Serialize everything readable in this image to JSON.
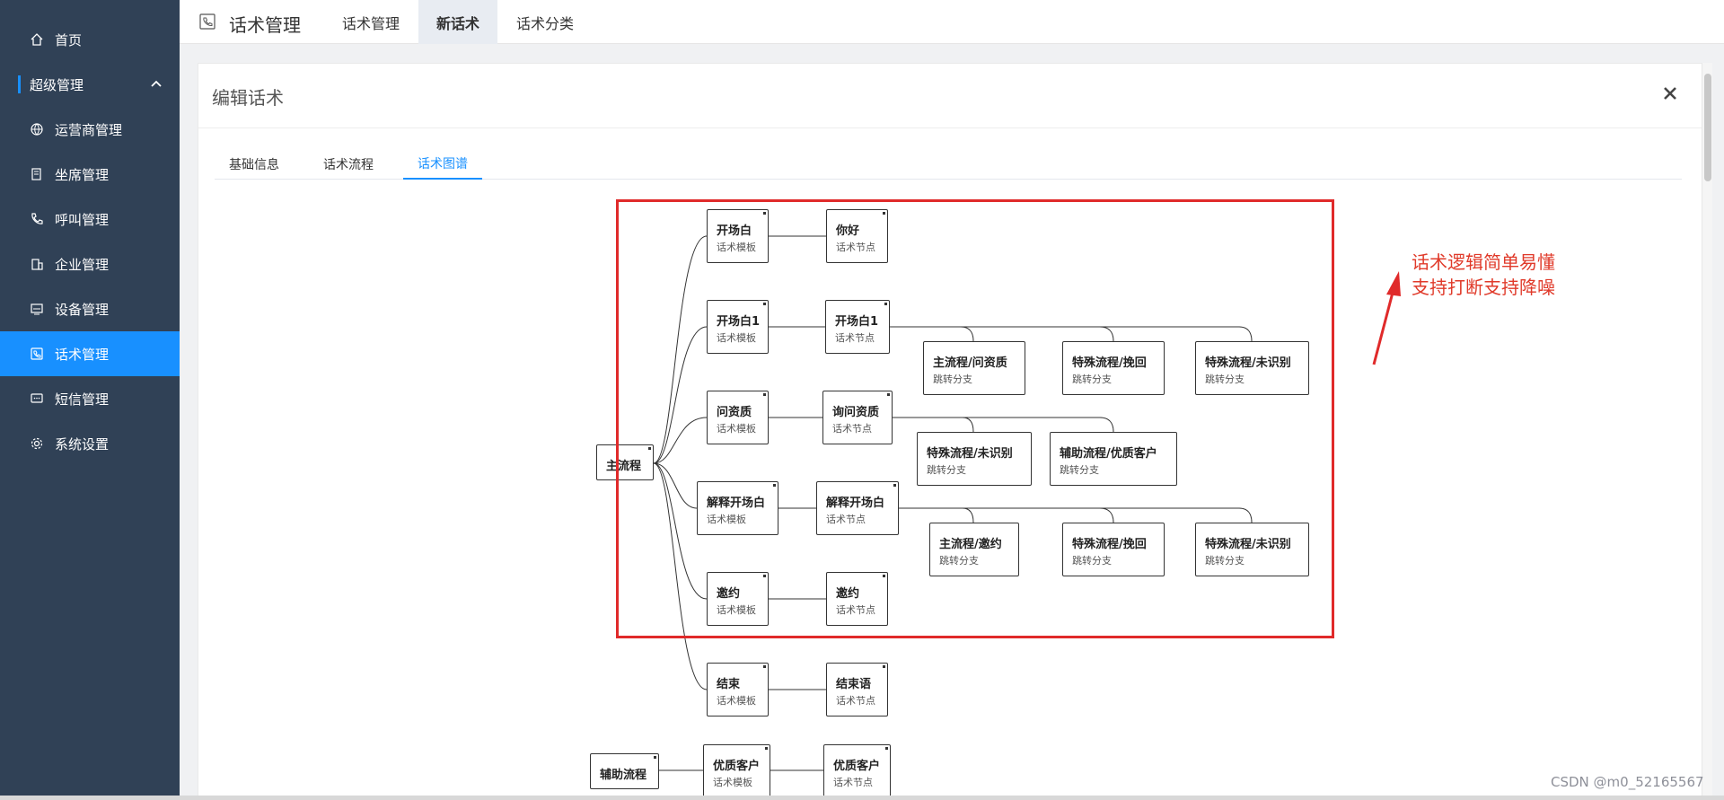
{
  "sidebar": {
    "items": [
      {
        "label": "首页",
        "icon": "home-icon"
      },
      {
        "label": "运营商管理",
        "icon": "globe-icon"
      },
      {
        "label": "坐席管理",
        "icon": "seat-icon"
      },
      {
        "label": "呼叫管理",
        "icon": "phone-icon"
      },
      {
        "label": "企业管理",
        "icon": "building-icon"
      },
      {
        "label": "设备管理",
        "icon": "device-icon"
      },
      {
        "label": "话术管理",
        "icon": "script-icon"
      },
      {
        "label": "短信管理",
        "icon": "message-icon"
      },
      {
        "label": "系统设置",
        "icon": "gear-icon"
      }
    ],
    "group_label": "超级管理",
    "active_item": "话术管理",
    "colors": {
      "background": "#304156",
      "active": "#1890ff"
    }
  },
  "header": {
    "title": "话术管理",
    "tabs": [
      "话术管理",
      "新话术",
      "话术分类"
    ],
    "active_tab": "新话术"
  },
  "editor": {
    "title": "编辑话术",
    "tabs": [
      "基础信息",
      "话术流程",
      "话术图谱"
    ],
    "active_tab": "话术图谱"
  },
  "diagram": {
    "nodes": {
      "root": {
        "title": "主流程"
      },
      "t1": {
        "title": "开场白",
        "sub": "话术模板"
      },
      "n1": {
        "title": "你好",
        "sub": "话术节点"
      },
      "t2": {
        "title": "开场白1",
        "sub": "话术模板"
      },
      "n2": {
        "title": "开场白1",
        "sub": "话术节点"
      },
      "b21": {
        "title": "主流程/问资质",
        "sub": "跳转分支"
      },
      "b22": {
        "title": "特殊流程/挽回",
        "sub": "跳转分支"
      },
      "b23": {
        "title": "特殊流程/未识别",
        "sub": "跳转分支"
      },
      "t3": {
        "title": "问资质",
        "sub": "话术模板"
      },
      "n3": {
        "title": "询问资质",
        "sub": "话术节点"
      },
      "b31": {
        "title": "特殊流程/未识别",
        "sub": "跳转分支"
      },
      "b32": {
        "title": "辅助流程/优质客户",
        "sub": "跳转分支"
      },
      "t4": {
        "title": "解释开场白",
        "sub": "话术模板"
      },
      "n4": {
        "title": "解释开场白",
        "sub": "话术节点"
      },
      "b41": {
        "title": "主流程/邀约",
        "sub": "跳转分支"
      },
      "b42": {
        "title": "特殊流程/挽回",
        "sub": "跳转分支"
      },
      "b43": {
        "title": "特殊流程/未识别",
        "sub": "跳转分支"
      },
      "t5": {
        "title": "邀约",
        "sub": "话术模板"
      },
      "n5": {
        "title": "邀约",
        "sub": "话术节点"
      },
      "t6": {
        "title": "结束",
        "sub": "话术模板"
      },
      "n6": {
        "title": "结束语",
        "sub": "话术节点"
      },
      "aux": {
        "title": "辅助流程"
      },
      "t7": {
        "title": "优质客户",
        "sub": "话术模板"
      },
      "n7": {
        "title": "优质客户",
        "sub": "话术节点"
      }
    },
    "annotation": [
      "话术逻辑简单易懂",
      "支持打断支持降噪"
    ],
    "highlight_color": "#e02a2a"
  },
  "watermark": "CSDN @m0_52165567"
}
